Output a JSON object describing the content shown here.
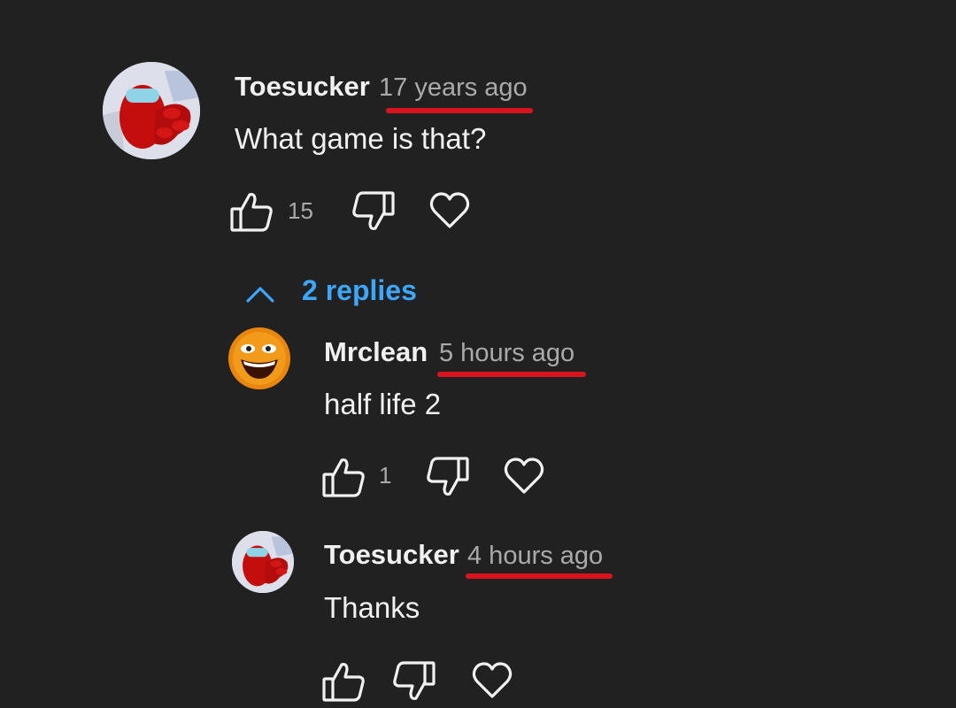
{
  "comment": {
    "author": "Toesucker",
    "time": "17 years ago",
    "text": "What game is that?",
    "likes": "15"
  },
  "replies_toggle": {
    "label": "2 replies"
  },
  "replies": [
    {
      "author": "Mrclean",
      "time": "5 hours ago",
      "text": "half life 2",
      "likes": "1"
    },
    {
      "author": "Toesucker",
      "time": "4 hours ago",
      "text": "Thanks",
      "likes": ""
    }
  ],
  "colors": {
    "background": "#212121",
    "underline": "#d9141e",
    "link": "#3ea6ff",
    "secondary_text": "#aaaaaa"
  },
  "icons": [
    "red-crewmate-avatar-icon",
    "orange-face-avatar-icon",
    "thumbs-up-icon",
    "thumbs-down-icon",
    "heart-icon",
    "chevron-up-icon"
  ]
}
